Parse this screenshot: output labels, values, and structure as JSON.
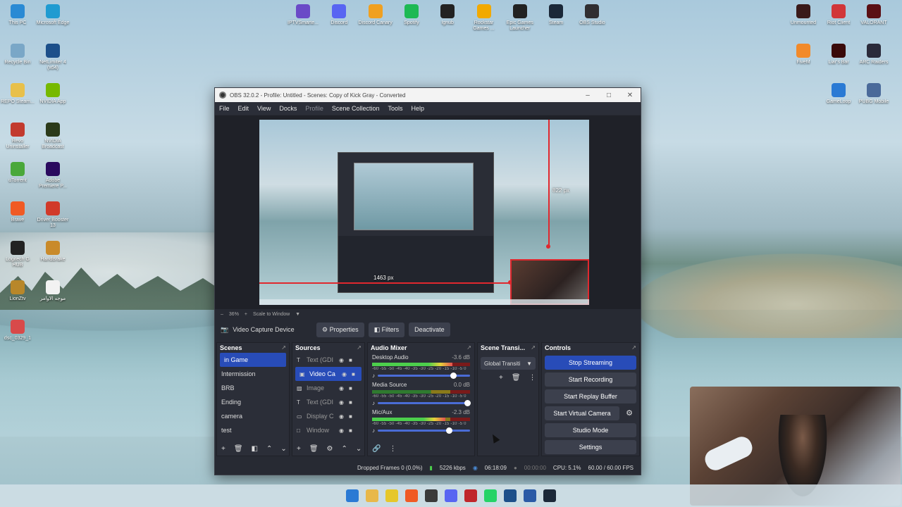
{
  "desktop_icons_left": [
    {
      "label": "This PC",
      "icon": "monitor-icon",
      "color": "#2a8ad4"
    },
    {
      "label": "Microsoft Edge",
      "icon": "edge-icon",
      "color": "#1f9bd1"
    },
    {
      "label": "Recycle Bin",
      "icon": "recycle-bin-icon",
      "color": "#7aa7c7"
    },
    {
      "label": "NetLimiter 4 (x64)",
      "icon": "netlimiter-icon",
      "color": "#1c4f8a"
    },
    {
      "label": "REPO Steam...",
      "icon": "folder-icon",
      "color": "#e8c04a"
    },
    {
      "label": "NVIDIA App",
      "icon": "nvidia-icon",
      "color": "#76b900"
    },
    {
      "label": "Revo Uninstaller",
      "icon": "revo-icon",
      "color": "#c23a2e"
    },
    {
      "label": "NVIDIA Broadcast",
      "icon": "nvidia-broadcast-icon",
      "color": "#2b3a1a"
    },
    {
      "label": "uTorrent",
      "icon": "utorrent-icon",
      "color": "#4aa83a"
    },
    {
      "label": "Adobe Premiere P...",
      "icon": "premiere-icon",
      "color": "#2a0a5e"
    },
    {
      "label": "Brave",
      "icon": "brave-icon",
      "color": "#f05a24"
    },
    {
      "label": "Driver Booster 13",
      "icon": "driver-booster-icon",
      "color": "#d13a2a"
    },
    {
      "label": "Logitech G HUB",
      "icon": "logitech-icon",
      "color": "#222222"
    },
    {
      "label": "HandBrake",
      "icon": "handbrake-icon",
      "color": "#c98a2a"
    },
    {
      "label": "LionZtv",
      "icon": "lion-icon",
      "color": "#b8872a"
    },
    {
      "label": "موجه الاوامر",
      "icon": "file-icon",
      "color": "#f2f2f2"
    },
    {
      "label": "dsc_0329_1",
      "icon": "image-file-icon",
      "color": "#d84a4a"
    }
  ],
  "desktop_icons_top": [
    {
      "label": "IPTVSmarte...",
      "icon": "iptv-icon",
      "color": "#6a4ac7"
    },
    {
      "label": "Discord",
      "icon": "discord-icon",
      "color": "#5865f2"
    },
    {
      "label": "Discord Canary",
      "icon": "discord-canary-icon",
      "color": "#f0a020"
    },
    {
      "label": "Spotify",
      "icon": "spotify-icon",
      "color": "#1db954"
    },
    {
      "label": "Ignub",
      "icon": "github-icon",
      "color": "#222222"
    },
    {
      "label": "Rockstar Games ...",
      "icon": "rockstar-icon",
      "color": "#f2a900"
    },
    {
      "label": "Epic Games Launcher",
      "icon": "epic-icon",
      "color": "#222222"
    },
    {
      "label": "Steam",
      "icon": "steam-icon",
      "color": "#1b2838"
    },
    {
      "label": "OBS Studio",
      "icon": "obs-icon",
      "color": "#302e31"
    }
  ],
  "desktop_icons_right": [
    {
      "label": "Unmounted",
      "icon": "unmounted-icon",
      "color": "#3a1a1a"
    },
    {
      "label": "Riot Client",
      "icon": "riot-icon",
      "color": "#d13639"
    },
    {
      "label": "VALORANT",
      "icon": "valorant-icon",
      "color": "#5a0f14"
    },
    {
      "label": "FiveM",
      "icon": "fivem-icon",
      "color": "#f28a2a"
    },
    {
      "label": "Liar's Bar",
      "icon": "liars-bar-icon",
      "color": "#3a0a0a"
    },
    {
      "label": "ARC Raiders",
      "icon": "arc-raiders-icon",
      "color": "#2a2a3a"
    },
    {
      "label": "GameLoop",
      "icon": "gameloop-icon",
      "color": "#2a7ad4"
    },
    {
      "label": "PUBG Mobile",
      "icon": "pubg-icon",
      "color": "#4a6a9a"
    }
  ],
  "window": {
    "title": "OBS 32.0.2 - Profile: Untitled - Scenes: Copy of Kick Gray - Converted"
  },
  "menu": [
    "File",
    "Edit",
    "View",
    "Docks",
    "Profile",
    "Scene Collection",
    "Tools",
    "Help"
  ],
  "preview": {
    "vertical_measure": "822 px",
    "horizontal_measure": "1463 px",
    "zoom": "36%",
    "scale_mode": "Scale to Window"
  },
  "source_toolbar": {
    "selected_source": "Video Capture Device",
    "properties": "Properties",
    "filters": "Filters",
    "deactivate": "Deactivate"
  },
  "scenes": {
    "title": "Scenes",
    "items": [
      "in Game",
      "Intermission",
      "BRB",
      "Ending",
      "camera",
      "test"
    ],
    "selected": "in Game"
  },
  "sources": {
    "title": "Sources",
    "items": [
      {
        "name": "Text (GDI",
        "icon": "text-icon"
      },
      {
        "name": "Video Ca",
        "icon": "camera-icon",
        "selected": true
      },
      {
        "name": "Image",
        "icon": "image-icon"
      },
      {
        "name": "Text (GDI",
        "icon": "text-icon"
      },
      {
        "name": "Display C",
        "icon": "display-icon"
      },
      {
        "name": "Window",
        "icon": "window-icon"
      }
    ]
  },
  "audio_mixer": {
    "title": "Audio Mixer",
    "scale": "-60 -55 -50 -45 -40 -35 -30 -25 -20 -15 -10 -5 0",
    "channels": [
      {
        "name": "Desktop Audio",
        "db": "-3.6 dB",
        "level": 0.82,
        "volume": 0.85
      },
      {
        "name": "Media Source",
        "db": "0.0 dB",
        "level": 0.0,
        "volume": 1.0
      },
      {
        "name": "Mic/Aux",
        "db": "-2.3 dB",
        "level": 0.75,
        "volume": 0.8
      }
    ]
  },
  "transitions": {
    "title": "Scene Transi...",
    "selected": "Global Transiti"
  },
  "controls": {
    "title": "Controls",
    "stop_streaming": "Stop Streaming",
    "start_recording": "Start Recording",
    "start_replay": "Start Replay Buffer",
    "start_virtual": "Start Virtual Camera",
    "studio_mode": "Studio Mode",
    "settings": "Settings"
  },
  "status": {
    "dropped": "Dropped Frames 0 (0.0%)",
    "bitrate": "5226 kbps",
    "stream_time": "06:18:09",
    "rec_time": "00:00:00",
    "cpu": "CPU: 5.1%",
    "fps": "60.00 / 60.00 FPS"
  },
  "taskbar": [
    {
      "icon": "windows-start-icon",
      "color": "#2a7ad4"
    },
    {
      "icon": "file-explorer-icon",
      "color": "#e8b84a"
    },
    {
      "icon": "whatsapp-icon",
      "color": "#e6c72a"
    },
    {
      "icon": "brave-icon",
      "color": "#f05a24"
    },
    {
      "icon": "chrome-icon",
      "color": "#3a3a3a"
    },
    {
      "icon": "discord-icon",
      "color": "#5865f2"
    },
    {
      "icon": "record-icon",
      "color": "#c0262b"
    },
    {
      "icon": "whatsapp-icon",
      "color": "#25d366"
    },
    {
      "icon": "netlimiter-icon",
      "color": "#1c4f8a"
    },
    {
      "icon": "monitor-icon",
      "color": "#2a5aa6"
    },
    {
      "icon": "steam-icon",
      "color": "#1b2838"
    }
  ]
}
